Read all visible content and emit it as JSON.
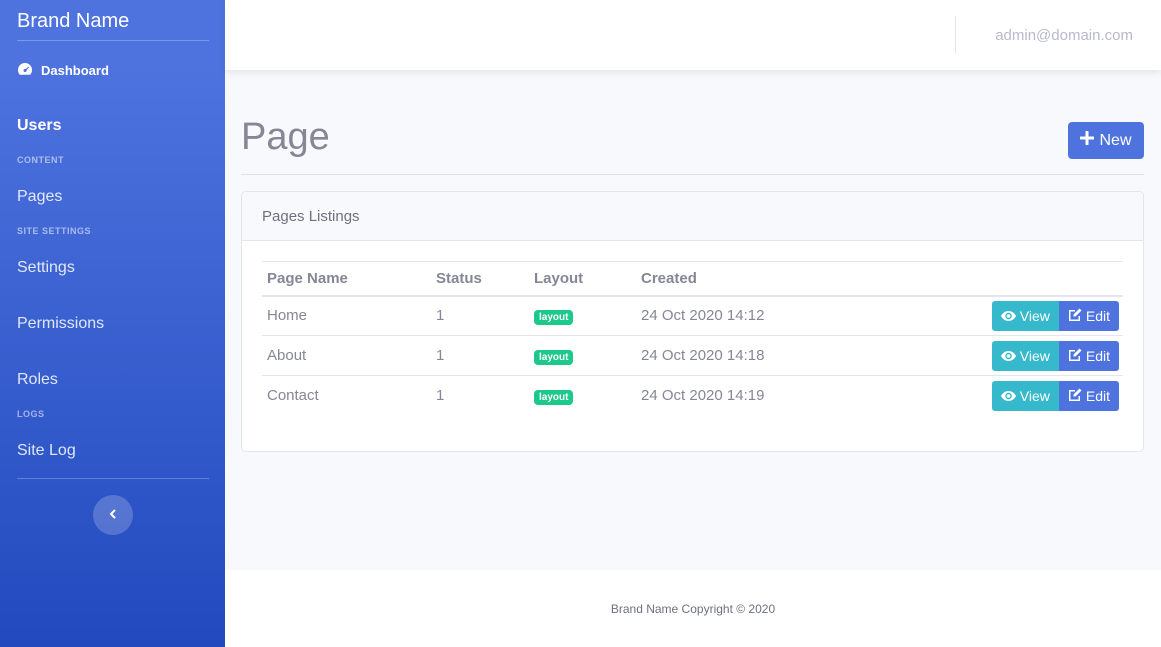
{
  "sidebar": {
    "brand": "Brand Name",
    "dashboard": "Dashboard",
    "users": "Users",
    "heading_content": "CONTENT",
    "pages": "Pages",
    "heading_site_settings": "SITE SETTINGS",
    "settings": "Settings",
    "permissions": "Permissions",
    "roles": "Roles",
    "heading_logs": "LOGS",
    "site_log": "Site Log"
  },
  "topbar": {
    "user_email": "admin@domain.com"
  },
  "main": {
    "title": "Page",
    "new_button": "New",
    "card_title": "Pages Listings",
    "columns": [
      "Page Name",
      "Status",
      "Layout",
      "Created"
    ],
    "rows": [
      {
        "name": "Home",
        "status": "1",
        "layout": "layout",
        "created": "24 Oct 2020 14:12"
      },
      {
        "name": "About",
        "status": "1",
        "layout": "layout",
        "created": "24 Oct 2020 14:18"
      },
      {
        "name": "Contact",
        "status": "1",
        "layout": "layout",
        "created": "24 Oct 2020 14:19"
      }
    ],
    "view_label": "View",
    "edit_label": "Edit"
  },
  "footer": {
    "text": "Brand Name Copyright © 2020"
  },
  "colors": {
    "primary": "#4e73df",
    "info": "#36b9cc",
    "success": "#1cc88a"
  }
}
